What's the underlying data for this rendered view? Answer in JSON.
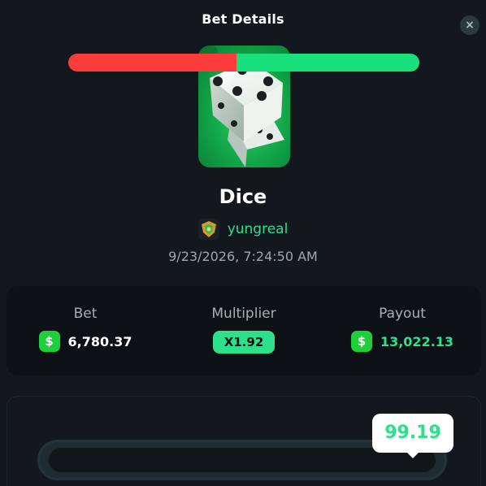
{
  "modal": {
    "title": "Bet Details",
    "close_label": "×"
  },
  "game": {
    "name": "Dice",
    "image_icon": "dice-game-icon"
  },
  "user": {
    "name": "yungreal",
    "badge_icon": "rank-shield-icon"
  },
  "timestamp": "9/23/2026, 7:24:50 AM",
  "stats": {
    "bet": {
      "label": "Bet",
      "currency_symbol": "$",
      "amount": "6,780.37"
    },
    "multiplier": {
      "label": "Multiplier",
      "value": "X1.92"
    },
    "payout": {
      "label": "Payout",
      "currency_symbol": "$",
      "amount": "13,022.13"
    }
  },
  "dice_result": {
    "value": "99.19",
    "roll_over_threshold": 48,
    "result_position": 99.19
  },
  "colors": {
    "background": "#12181d",
    "accent_green": "#2de08c",
    "lose_red": "#fc3b3b",
    "win_green": "#18e07a",
    "coin_green": "#1fcf3a"
  }
}
